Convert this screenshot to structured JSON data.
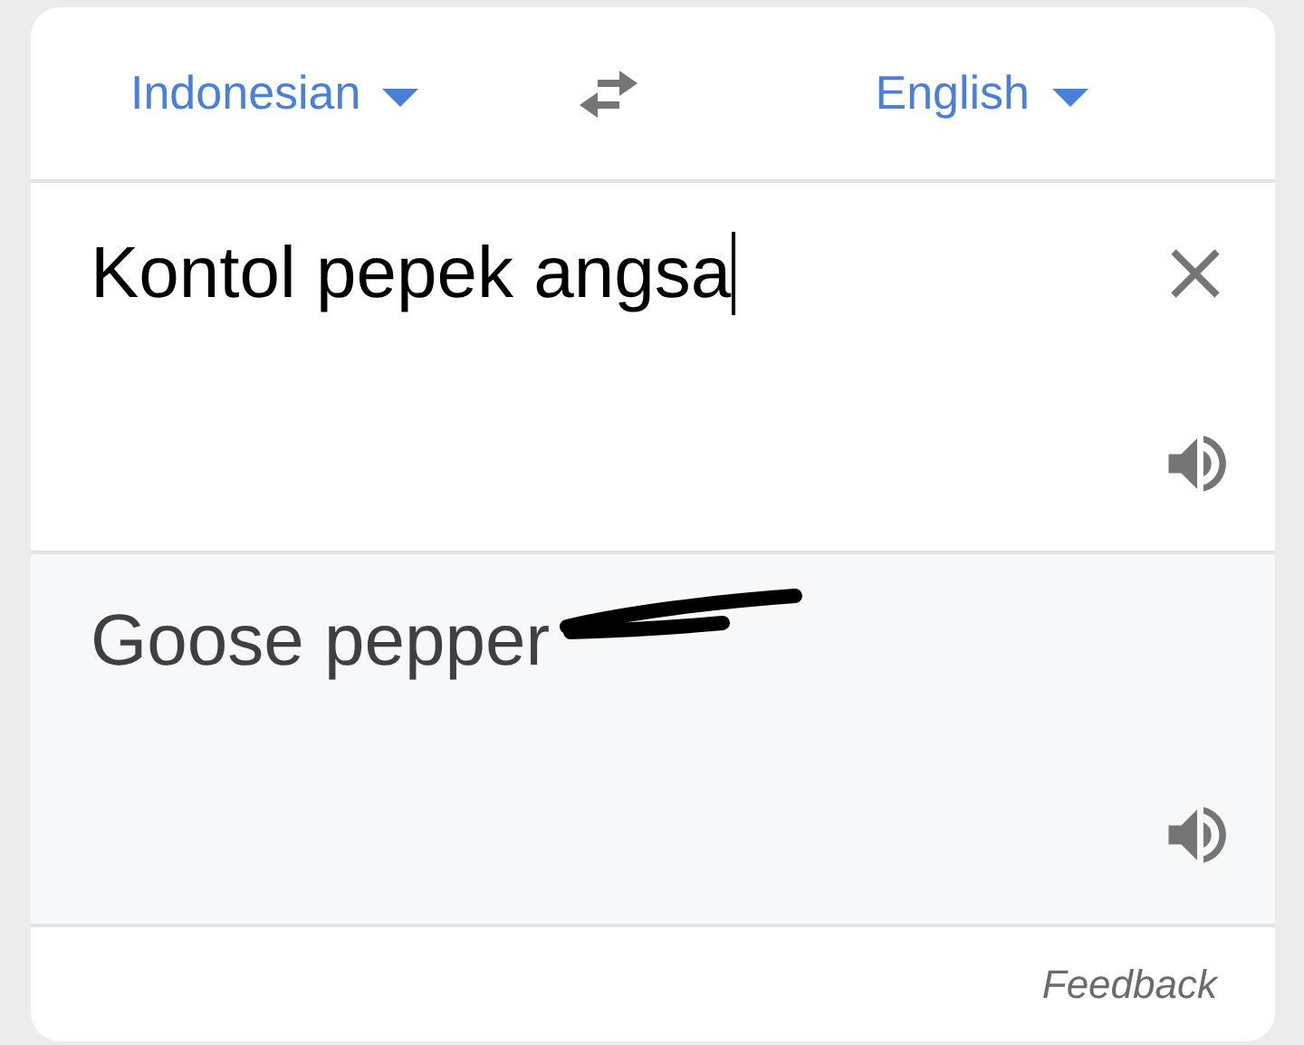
{
  "languages": {
    "source": "Indonesian",
    "target": "English"
  },
  "input": {
    "value": "Kontol pepek angsa"
  },
  "output": {
    "text": "Goose pepper",
    "scribbled_over": true
  },
  "feedback": "Feedback"
}
